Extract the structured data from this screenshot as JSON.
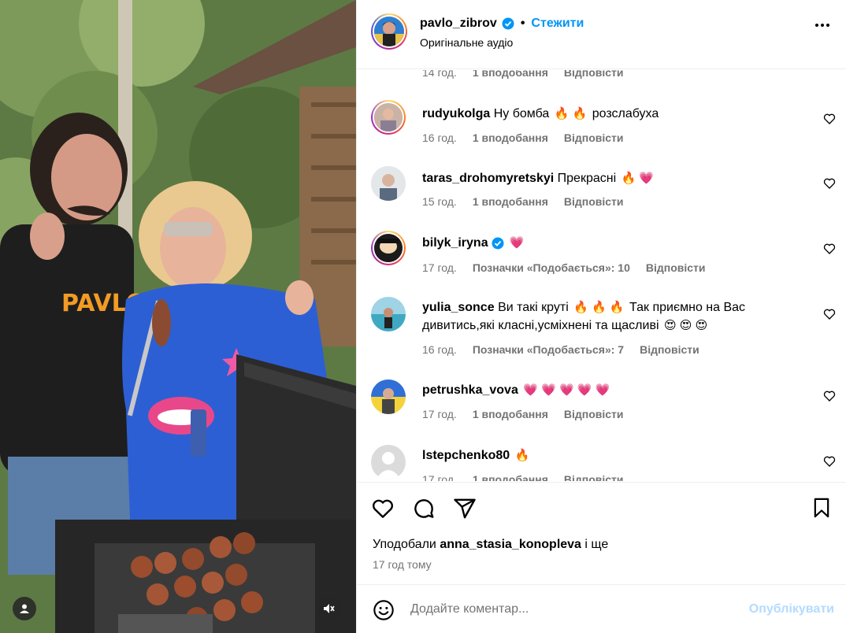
{
  "header": {
    "username": "pavlo_zibrov",
    "separator": "•",
    "follow_label": "Стежити",
    "audio_label": "Оригінальне аудіо"
  },
  "comments": [
    {
      "user": "",
      "text": "",
      "time": "14 год.",
      "likes": "1 вподобання",
      "reply": "Відповісти"
    },
    {
      "user": "rudyukolga",
      "text": "Ну бомба",
      "emoji": "🔥 🔥",
      "tail": "розслабуха",
      "time": "16 год.",
      "likes": "1 вподобання",
      "reply": "Відповісти"
    },
    {
      "user": "taras_drohomyretskyi",
      "text": "Прекрасні",
      "emoji": "🔥 💗",
      "time": "15 год.",
      "likes": "1 вподобання",
      "reply": "Відповісти"
    },
    {
      "user": "bilyk_iryna",
      "text": "",
      "emoji": "💗",
      "time": "17 год.",
      "likes": "Позначки «Подобається»: 10",
      "reply": "Відповісти"
    },
    {
      "user": "yulia_sonce",
      "text": "Ви такі круті",
      "emoji": "🔥 🔥 🔥",
      "tail": "Так приємно на Вас дивитись,які класні,усміхнені та щасливі",
      "emoji2": "😍 😍 😍",
      "time": "16 год.",
      "likes": "Позначки «Подобається»: 7",
      "reply": "Відповісти"
    },
    {
      "user": "petrushka_vova",
      "text": "",
      "emoji": "💗 💗 💗 💗 💗",
      "time": "17 год.",
      "likes": "1 вподобання",
      "reply": "Відповісти"
    },
    {
      "user": "lstepchenko80",
      "text": "",
      "emoji": "🔥",
      "time": "17 год.",
      "likes": "1 вподобання",
      "reply": "Відповісти"
    }
  ],
  "actions": {
    "liked_by_prefix": "Уподобали",
    "liked_by_user": "anna_stasia_konopleva",
    "liked_by_suffix": "і ще",
    "time_ago": "17 год тому"
  },
  "composer": {
    "placeholder": "Додайте коментар...",
    "publish_label": "Опублікувати"
  },
  "colors": {
    "accent": "#0095f6",
    "publish_disabled": "#b3dbff",
    "meta": "#737373",
    "verified": "#0095f6"
  },
  "icons": [
    "heart-icon",
    "comment-icon",
    "share-icon",
    "bookmark-icon",
    "emoji-icon",
    "user-icon",
    "mute-icon",
    "more-icon",
    "verified-icon"
  ]
}
